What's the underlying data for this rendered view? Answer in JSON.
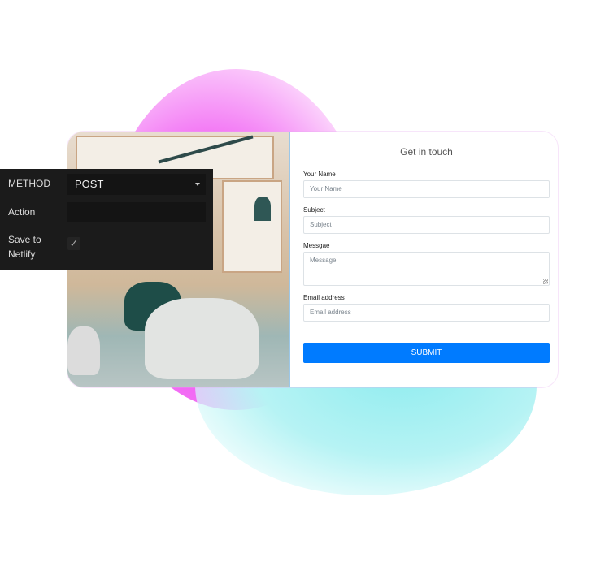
{
  "settings_panel": {
    "method_label": "METHOD",
    "method_value": "POST",
    "action_label": "Action",
    "action_value": "",
    "save_label": "Save to Netlify",
    "save_checked": true
  },
  "form": {
    "title": "Get in touch",
    "fields": [
      {
        "label": "Your Name",
        "placeholder": "Your Name"
      },
      {
        "label": "Subject",
        "placeholder": "Subject"
      },
      {
        "label": "Messgae",
        "placeholder": "Message"
      },
      {
        "label": "Email address",
        "placeholder": "Email address"
      }
    ],
    "submit_label": "SUBMIT",
    "submit_color": "#007bff"
  },
  "icons": {
    "dropdown": "caret-down-icon",
    "check": "checkmark-icon"
  }
}
